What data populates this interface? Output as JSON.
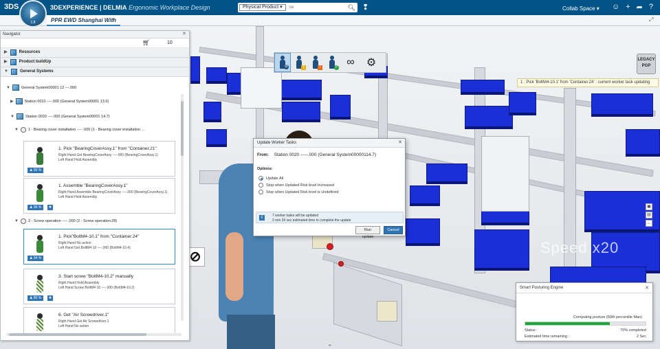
{
  "header": {
    "logo": "3DS",
    "compass_version": "1.8",
    "brand": "3DEXPERIENCE | DELMIA",
    "app_name": "Ergonomic Workplace Design",
    "search_scope": "Physical Product ▾",
    "search_placeholder": "Se",
    "collab_space": "Collab Space ▾"
  },
  "tabs": [
    {
      "label": "PPR EWD Shanghai With"
    }
  ],
  "toolbar": {
    "buttons": [
      "worker-check-icon",
      "worker-warning-icon",
      "worker-alert-icon",
      "worker-ok-icon",
      "glasses-icon",
      "gear-icon"
    ]
  },
  "ergo_logo": "LEGACY\nPGP",
  "status_bubble": "1 : Pick 'BoltM4-10.1' from 'Container.24' : current worker task updating",
  "watermark": "Speed x20",
  "navigator": {
    "title": "Navigator",
    "cart_count": "10",
    "sections": [
      "Resources",
      "Product buildUp",
      "General Systems"
    ],
    "tree": [
      "General System00001 12 ---.000",
      "Station 0010 ----.000 (General System00001 13.6)",
      "Station 0020 ----.000 (General System00001 14.7)",
      "1 - Bearing cover installation ---- .000 (1 - Bearing cover installation ...",
      "2 - Screw operation ---- .000 (2 - Screw operation.28)"
    ],
    "tasks": [
      {
        "title": "1. Pick \"BearingCoverAssy.1\" from \"Container.21\"",
        "line1": "Right Hand Get BearingCoverAssy ----.000 (BearingCoverAssy.1)",
        "line2": "Left Hand Hold Assembly",
        "pct": "93 %",
        "color": "#3a7a3a",
        "star": false
      },
      {
        "title": "1. Assemble \"BearingCoverAssy.1\"",
        "line1": "Right Hand Assemble BearingCoverAssy ----.000 (BearingCoverAssy.1)",
        "line2": "Left Hand Hold Assembly",
        "pct": "96 %",
        "color": "#3a8a3a",
        "star": true
      },
      {
        "title": "1. Pick\"BoltM4-10.1\" from \"Container.24\"",
        "line1": "Right Hand No action",
        "line2": "Left Hand Get BoltM4-10 ----.000 (BoltM4-10.4)",
        "pct": "94 %",
        "color": "#3a8a3a",
        "star": false
      },
      {
        "title": "3. Start screw \"BoltM4-10.2\" manually",
        "line1": "Right Hand Hold Assembly",
        "line2": "Left Hand Screw BoltM4-10 ----.000 (BoltM4-10.2)",
        "pct": "80 %",
        "color": "#5a8a3a",
        "star": true
      },
      {
        "title": "6. Get \"Air Screwdriver.1\"",
        "line1": "Right Hand Get Air Screwdriver.1",
        "line2": "Left Hand No action",
        "pct": "",
        "color": "#5a8a3a",
        "star": false
      }
    ]
  },
  "dialog": {
    "title": "Update Worker Tasks",
    "from_label": "From:",
    "from_value": "Station 0020 -----.000 (General System00000114.7)",
    "options_label": "Options:",
    "options": [
      "Update All",
      "Stop when Updated Risk level Increased",
      "Stop when Updated Risk level is Undefined"
    ],
    "selected_option": 0,
    "info_line1": "7 worker tasks will be updated",
    "info_line2": "2 min 34 sec estimated time to complete the update",
    "run_button": "Run update",
    "cancel_button": "Cancel"
  },
  "posturing": {
    "title": "Smart Posturing Engine",
    "message": "Computing posture (50th percentile Man)",
    "progress": 0.7,
    "status_label": "Status :",
    "status_value": "70% completed",
    "time_label": "Estimated time remaining :",
    "time_value": "2 Sec"
  },
  "colors": {
    "brand": "#005386",
    "bins": "#1a2fd6",
    "accent": "#2f75b5",
    "progress": "#1ea53c"
  }
}
